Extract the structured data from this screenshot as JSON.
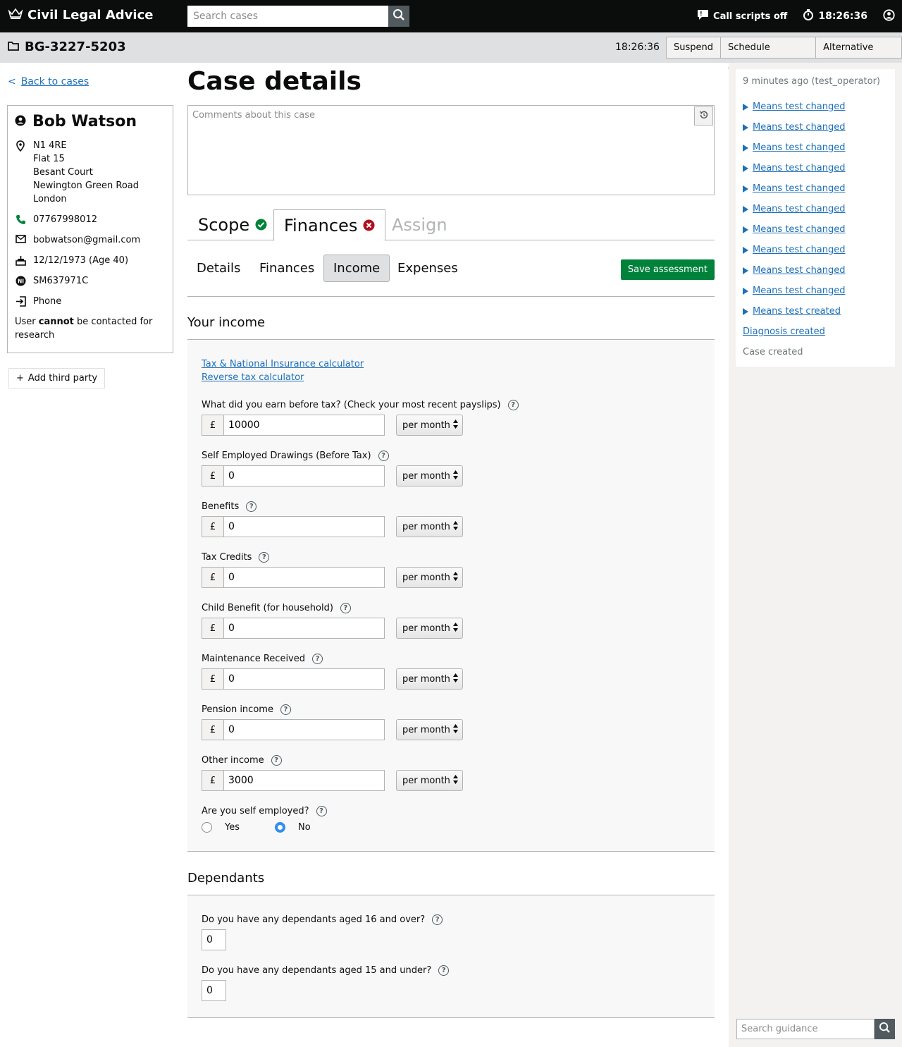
{
  "header": {
    "app_title": "Civil Legal Advice",
    "search_placeholder": "Search cases",
    "call_scripts": "Call scripts off",
    "clock": "18:26:36"
  },
  "case_bar": {
    "case_ref": "BG-3227-5203",
    "time": "18:26:36",
    "buttons": [
      "Suspend",
      "Schedule callback",
      "Alternative help"
    ]
  },
  "left": {
    "back_link": "Back to cases",
    "back_chevron": "<",
    "person": {
      "name": "Bob Watson",
      "address": [
        "N1 4RE",
        "Flat 15",
        "Besant Court",
        "Newington Green Road",
        "London"
      ],
      "phone": "07767998012",
      "email": "bobwatson@gmail.com",
      "dob": "12/12/1973 (Age 40)",
      "ni_number": "SM637971C",
      "contact_method": "Phone",
      "research_prefix": "User ",
      "research_bold": "cannot",
      "research_suffix": " be contacted for research"
    },
    "add_third_party": "Add third party"
  },
  "main": {
    "title": "Case details",
    "comments_placeholder": "Comments about this case",
    "tabs": [
      {
        "label": "Scope",
        "status": "complete"
      },
      {
        "label": "Finances",
        "status": "error"
      },
      {
        "label": "Assign",
        "status": "disabled"
      }
    ],
    "subtabs": [
      "Details",
      "Finances",
      "Income",
      "Expenses"
    ],
    "active_subtab": "Income",
    "save_button": "Save assessment",
    "income_heading": "Your income",
    "calc_links": [
      "Tax & National Insurance calculator",
      "Reverse tax calculator"
    ],
    "currency_symbol": "£",
    "help_glyph": "?",
    "income_fields": [
      {
        "label": "What did you earn before tax? (Check your most recent payslips)",
        "value": "10000",
        "period": "per month"
      },
      {
        "label": "Self Employed Drawings (Before Tax)",
        "value": "0",
        "period": "per month"
      },
      {
        "label": "Benefits",
        "value": "0",
        "period": "per month"
      },
      {
        "label": "Tax Credits",
        "value": "0",
        "period": "per month"
      },
      {
        "label": "Child Benefit (for household)",
        "value": "0",
        "period": "per month"
      },
      {
        "label": "Maintenance Received",
        "value": "0",
        "period": "per month"
      },
      {
        "label": "Pension income",
        "value": "0",
        "period": "per month"
      },
      {
        "label": "Other income",
        "value": "3000",
        "period": "per month"
      }
    ],
    "self_employed": {
      "label": "Are you self employed?",
      "options": [
        "Yes",
        "No"
      ],
      "selected": "No"
    },
    "dependants_heading": "Dependants",
    "dependants": [
      {
        "label": "Do you have any dependants aged 16 and over?",
        "value": "0"
      },
      {
        "label": "Do you have any dependants aged 15 and under?",
        "value": "0"
      }
    ]
  },
  "right": {
    "log_time": "9 minutes ago (test_operator)",
    "log_entries": [
      "Means test changed",
      "Means test changed",
      "Means test changed",
      "Means test changed",
      "Means test changed",
      "Means test changed",
      "Means test changed",
      "Means test changed",
      "Means test changed",
      "Means test changed",
      "Means test created"
    ],
    "diagnosis_link": "Diagnosis created",
    "case_created": "Case created",
    "guidance_placeholder": "Search guidance"
  },
  "colors": {
    "brand_black": "#0b0c0c",
    "link": "#1d70b8",
    "success": "#00823b",
    "error": "#d4351c",
    "bar_grey": "#dee0e2"
  }
}
